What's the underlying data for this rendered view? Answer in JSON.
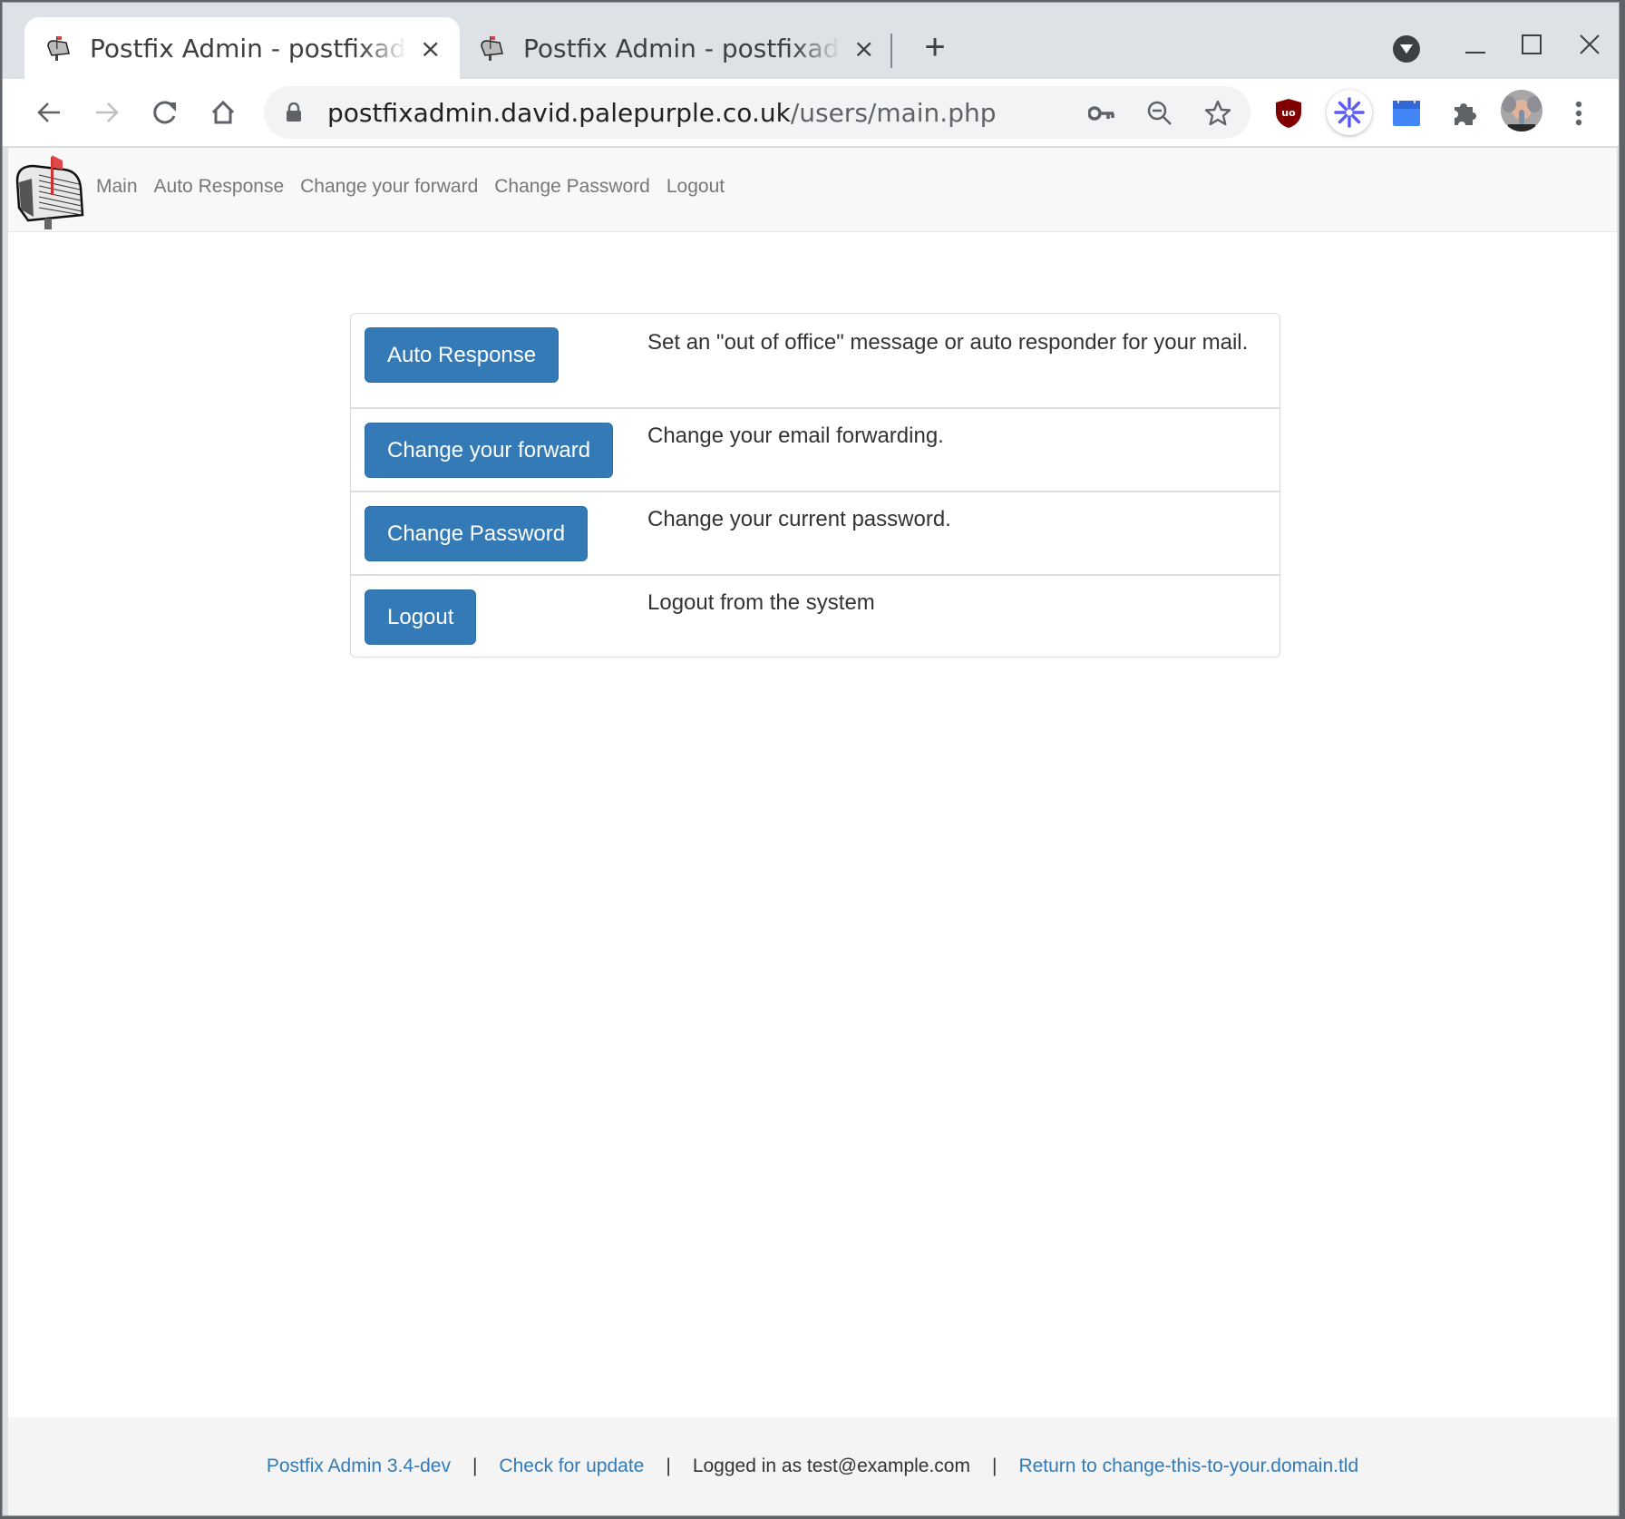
{
  "browser": {
    "tabs": [
      {
        "title": "Postfix Admin - postfixadmin.david.palepurple.co.uk",
        "active": true
      },
      {
        "title": "Postfix Admin - postfixadmin.david.palepurple.co.uk",
        "active": false
      }
    ],
    "new_tab_label": "+",
    "close_tab_label": "×",
    "url": {
      "host": "postfixadmin.david.palepurple.co.uk",
      "path": "/users/main.php"
    },
    "icons": {
      "back": "arrow-left-icon",
      "forward": "arrow-right-icon",
      "reload": "reload-icon",
      "home": "home-icon",
      "lock": "lock-icon",
      "password": "key-icon",
      "zoom": "zoom-out-icon",
      "bookmark": "star-icon",
      "extensions": [
        "ublock-origin-icon",
        "asterisk-extension-icon",
        "blue-folder-extension-icon",
        "puzzle-extensions-icon"
      ],
      "profile": "profile-avatar",
      "menu": "kebab-menu-icon"
    }
  },
  "nav": {
    "items": [
      {
        "label": "Main"
      },
      {
        "label": "Auto Response"
      },
      {
        "label": "Change your forward"
      },
      {
        "label": "Change Password"
      },
      {
        "label": "Logout"
      }
    ]
  },
  "panel": {
    "rows": [
      {
        "button": "Auto Response",
        "description": "Set an \"out of office\" message or auto responder for your mail."
      },
      {
        "button": "Change your forward",
        "description": "Change your email forwarding."
      },
      {
        "button": "Change Password",
        "description": "Change your current password."
      },
      {
        "button": "Logout",
        "description": "Logout from the system"
      }
    ]
  },
  "footer": {
    "version_link": "Postfix Admin 3.4-dev",
    "update_link": "Check for update",
    "logged_in": "Logged in as test@example.com",
    "return_link": "Return to change-this-to-your.domain.tld",
    "separator": "|"
  },
  "colors": {
    "primary_button": "#337ab7",
    "link": "#337ab7",
    "nav_text": "#777777",
    "navbar_bg": "#f8f8f8",
    "footer_bg": "#f4f4f4"
  }
}
